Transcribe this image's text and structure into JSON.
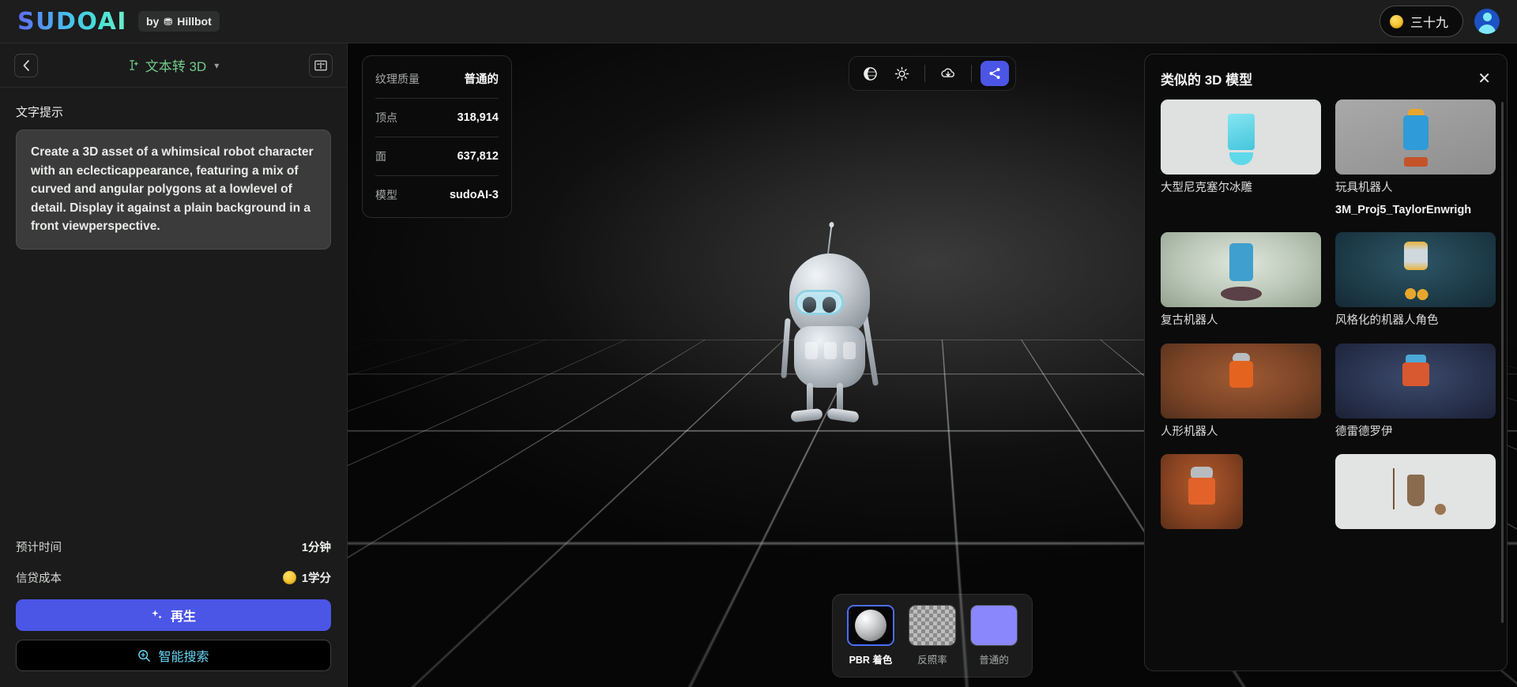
{
  "app": {
    "logo": "SUDOAI",
    "by_badge": "by",
    "by_brand": "Hillbot",
    "bot_icon": "bot-icon"
  },
  "topbar": {
    "credits_value": "三十九",
    "coin_icon": "coin-icon",
    "avatar_icon": "user-avatar-icon"
  },
  "sidebar": {
    "back_icon": "chevron-left-icon",
    "mode_icon": "text-cursor-icon",
    "mode_label": "文本转 3D",
    "chevron_icon": "chevron-down-icon",
    "library_icon": "book-icon",
    "prompt_label": "文字提示",
    "prompt_value": "Create a 3D asset of a whimsical robot character with an eclecticappearance, featuring a mix of curved and angular polygons at a lowlevel of detail. Display it against a plain background in a front viewperspective.",
    "estimate_label": "预计时间",
    "estimate_value": "1分钟",
    "cost_label": "信贷成本",
    "cost_value": "1学分",
    "cost_coin_icon": "coin-icon",
    "generate_icon": "sparkles-icon",
    "generate_label": "再生",
    "search_icon": "search-zoom-icon",
    "search_label": "智能搜索"
  },
  "stats": {
    "rows": [
      {
        "key": "纹理质量",
        "value": "普通的"
      },
      {
        "key": "顶点",
        "value": "318,914"
      },
      {
        "key": "面",
        "value": "637,812"
      },
      {
        "key": "模型",
        "value": "sudoAI-3"
      }
    ]
  },
  "toolbar": {
    "environment_icon": "globe-environment-icon",
    "brightness_icon": "sun-brightness-icon",
    "download_icon": "cloud-download-icon",
    "share_icon": "share-icon"
  },
  "materials": {
    "items": [
      {
        "label": "PBR 着色",
        "icon": "sphere-material-icon",
        "selected": true
      },
      {
        "label": "反照率",
        "icon": "checker-albedo-icon",
        "selected": false
      },
      {
        "label": "普通的",
        "icon": "normal-map-icon",
        "selected": false
      }
    ]
  },
  "similar_panel": {
    "title": "类似的 3D 模型",
    "close_icon": "close-icon",
    "cards": [
      {
        "title": "大型尼克塞尔冰雕",
        "subtitle": "",
        "thumb": "ice-sculpture-robot-thumb"
      },
      {
        "title": "玩具机器人",
        "subtitle": "3M_Proj5_TaylorEnwrigh",
        "thumb": "toy-robot-thumb"
      },
      {
        "title": "复古机器人",
        "subtitle": "",
        "thumb": "retro-robot-thumb"
      },
      {
        "title": "风格化的机器人角色",
        "subtitle": "",
        "thumb": "stylized-robot-thumb"
      },
      {
        "title": "人形机器人",
        "subtitle": "",
        "thumb": "humanoid-robot-thumb"
      },
      {
        "title": "德雷德罗伊",
        "subtitle": "",
        "thumb": "dreadroy-thumb"
      },
      {
        "title": "",
        "subtitle": "",
        "thumb": "orange-robot-thumb"
      },
      {
        "title": "",
        "subtitle": "",
        "thumb": "brown-robot-thumb"
      }
    ]
  },
  "colors": {
    "accent": "#4b55e6",
    "mode_green": "#74c98e",
    "search_cyan": "#69d7f5",
    "coin_yellow": "#f5c534",
    "normal_map": "#8a86fb"
  }
}
